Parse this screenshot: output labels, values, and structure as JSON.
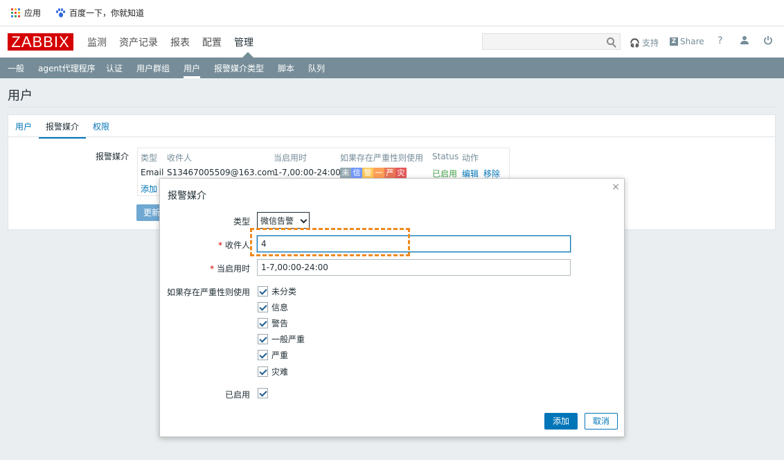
{
  "bookmarks": {
    "apps_label": "应用",
    "baidu_label": "百度一下，你就知道"
  },
  "header": {
    "logo": "ZABBIX",
    "nav": [
      "监测",
      "资产记录",
      "报表",
      "配置",
      "管理"
    ],
    "support_label": "支持",
    "share_label": "Share",
    "help_label": "?"
  },
  "subnav": [
    "一般",
    "agent代理程序",
    "认证",
    "用户群组",
    "用户",
    "报警媒介类型",
    "脚本",
    "队列"
  ],
  "page": {
    "title": "用户"
  },
  "tabs": [
    "用户",
    "报警媒介",
    "权限"
  ],
  "media": {
    "label": "报警媒介",
    "headers": {
      "type": "类型",
      "recipient": "收件人",
      "when": "当启用时",
      "severity": "如果存在严重性则使用",
      "status": "Status",
      "action": "动作"
    },
    "row": {
      "type": "Email",
      "recipient": "S13467005509@163.com",
      "when": "1-7,00:00-24:00",
      "severity": [
        "未",
        "信",
        "警",
        "一",
        "严",
        "灾"
      ],
      "severity_colors": [
        "#97aab3",
        "#7499ff",
        "#ffc859",
        "#ffa059",
        "#e97659",
        "#e45959"
      ],
      "status": "已启用",
      "edit": "编辑",
      "remove": "移除"
    },
    "add_link": "添加",
    "update_button": "更新"
  },
  "modal": {
    "title": "报警媒介",
    "close": "×",
    "type_label": "类型",
    "type_value": "微信告警",
    "recipient_label": "收件人",
    "recipient_value": "4",
    "when_label": "当启用时",
    "when_value": "1-7,00:00-24:00",
    "severity_label": "如果存在严重性则使用",
    "severities": [
      "未分类",
      "信息",
      "警告",
      "一般严重",
      "严重",
      "灾难"
    ],
    "enabled_label": "已启用",
    "add_button": "添加",
    "cancel_button": "取消"
  },
  "colors": {
    "brand": "#d40000",
    "accent": "#0275b8",
    "subnav": "#768d99",
    "highlight": "#ee8a1e"
  }
}
